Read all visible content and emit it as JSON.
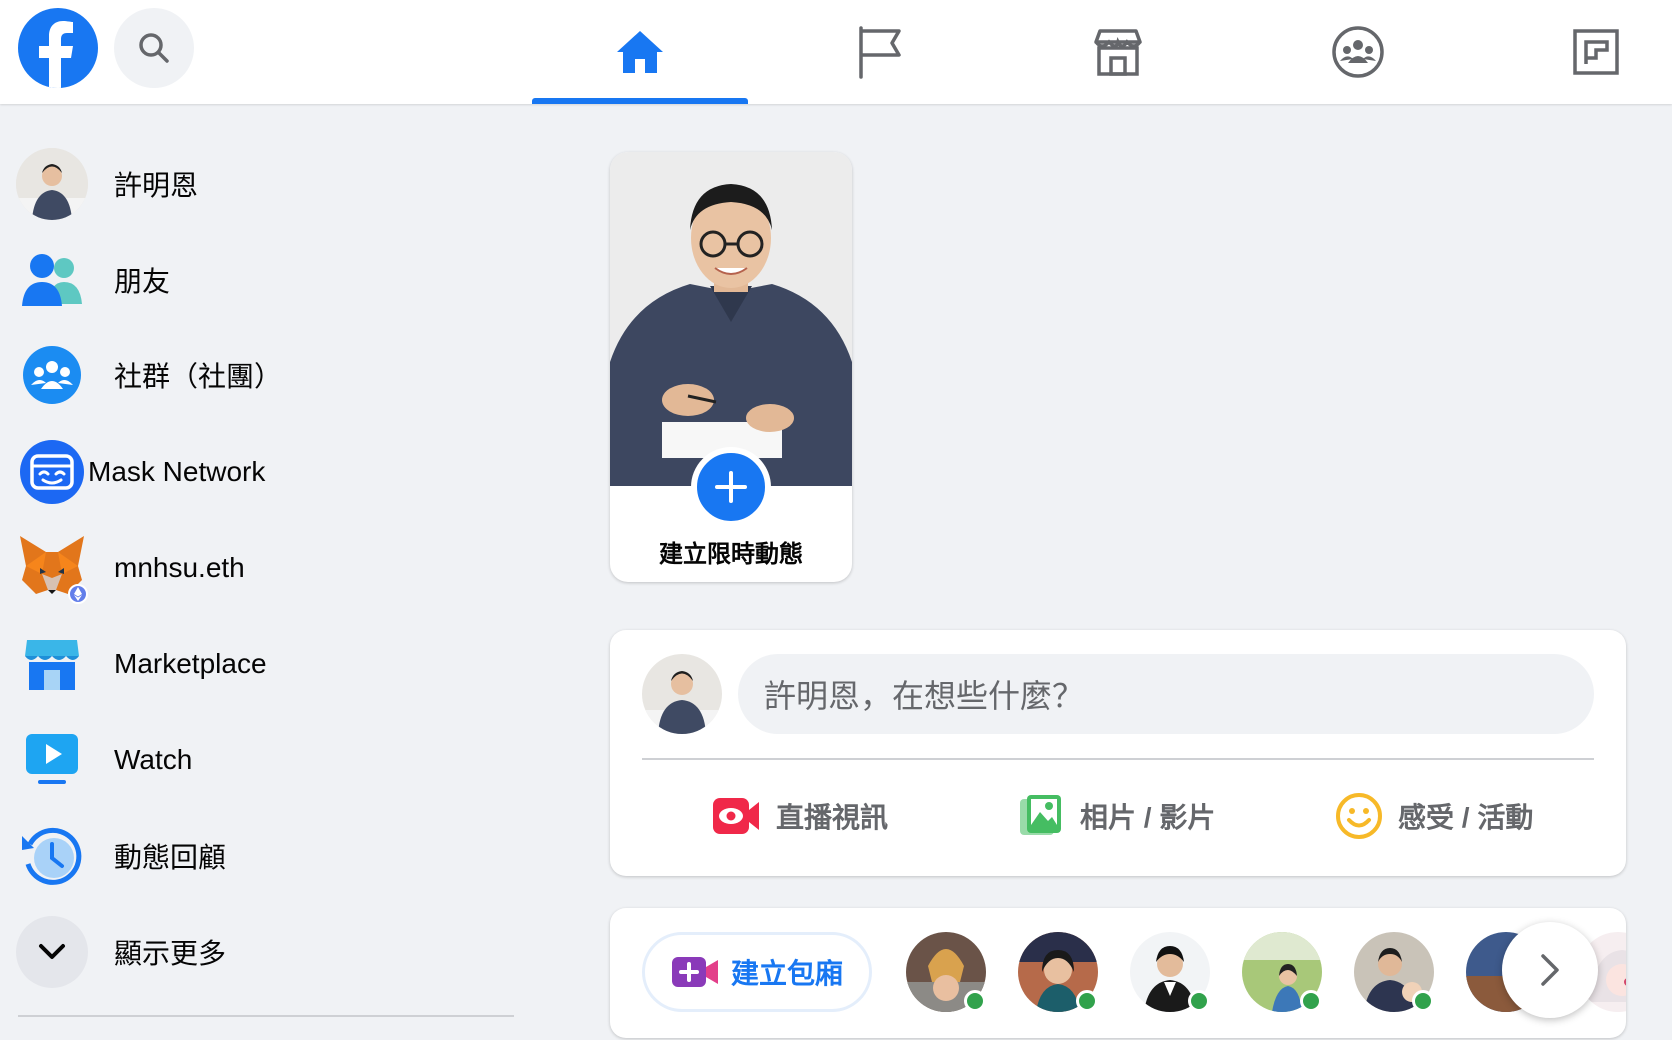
{
  "nav": {
    "tabs": [
      {
        "name": "home",
        "active": true
      },
      {
        "name": "pages",
        "active": false
      },
      {
        "name": "marketplace",
        "active": false
      },
      {
        "name": "groups",
        "active": false
      },
      {
        "name": "gaming",
        "active": false
      }
    ]
  },
  "sidebar": {
    "items": [
      {
        "label": "許明恩",
        "icon": "profile-avatar"
      },
      {
        "label": "朋友",
        "icon": "friends-icon"
      },
      {
        "label": "社群（社團）",
        "icon": "groups-icon"
      },
      {
        "label": "Mask Network",
        "icon": "mask-network-icon"
      },
      {
        "label": "mnhsu.eth",
        "icon": "metamask-fox-icon"
      },
      {
        "label": "Marketplace",
        "icon": "marketplace-icon"
      },
      {
        "label": "Watch",
        "icon": "watch-icon"
      },
      {
        "label": "動態回顧",
        "icon": "memories-icon"
      },
      {
        "label": "顯示更多",
        "icon": "chevron-down-icon"
      }
    ]
  },
  "story": {
    "create_label": "建立限時動態"
  },
  "composer": {
    "placeholder": "許明恩，在想些什麼？",
    "actions": [
      {
        "label": "直播視訊",
        "icon": "live-video-icon",
        "color": "#f02849"
      },
      {
        "label": "相片 / 影片",
        "icon": "photo-video-icon",
        "color": "#45bd62"
      },
      {
        "label": "感受 / 活動",
        "icon": "feeling-icon",
        "color": "#f7b928"
      }
    ]
  },
  "rooms": {
    "create_label": "建立包廂",
    "online_contacts": 6
  },
  "colors": {
    "brand": "#1877f2",
    "online": "#31a24c",
    "background": "#f0f2f5"
  }
}
